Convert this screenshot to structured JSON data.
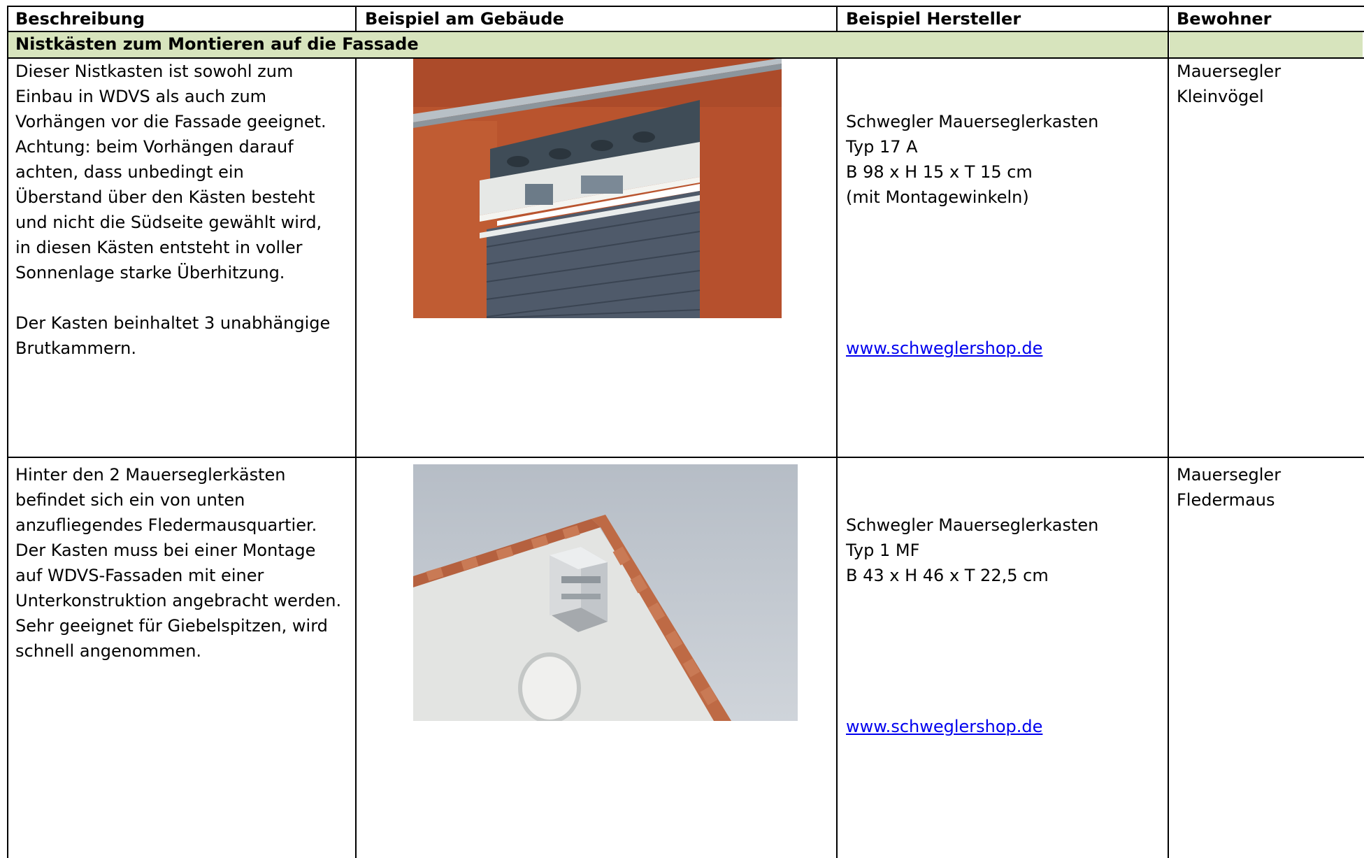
{
  "table": {
    "headers": [
      "Beschreibung",
      "Beispiel am Gebäude",
      "Beispiel Hersteller",
      "Bewohner"
    ],
    "section_title": "Nistkästen zum Montieren auf die Fassade",
    "rows": [
      {
        "description": "Dieser Nistkasten ist sowohl zum\nEinbau in WDVS als auch zum\nVorhängen vor die Fassade geeignet.\nAchtung: beim Vorhängen darauf\nachten, dass unbedingt ein\nÜberstand über den Kästen besteht\nund nicht die Südseite gewählt wird,\nin diesen Kästen entsteht in voller\nSonnenlage starke Überhitzung.\n\nDer Kasten beinhaltet 3 unabhängige\nBrutkammern.",
        "manufacturer": "Schwegler Mauerseglerkasten\nTyp 17 A\nB 98 x H 15 x T 15 cm\n(mit Montagewinkeln)",
        "link": "www.schweglershop.de",
        "residents": "Mauersegler\nKleinvögel"
      },
      {
        "description": "Hinter den 2 Mauerseglerkästen\nbefindet sich ein von unten\nanzufliegendes Fledermausquartier.\nDer Kasten muss bei einer Montage\nauf WDVS-Fassaden mit einer\nUnterkonstruktion angebracht werden.\nSehr geeignet für Giebelspitzen, wird\nschnell angenommen.",
        "manufacturer": "Schwegler Mauerseglerkasten\nTyp 1 MF\nB 43 x H 46 x T 22,5 cm",
        "link": "www.schweglershop.de",
        "residents": "Mauersegler\nFledermaus"
      }
    ]
  },
  "colors": {
    "section_background": "#d7e4bd",
    "link": "#0000ee"
  }
}
